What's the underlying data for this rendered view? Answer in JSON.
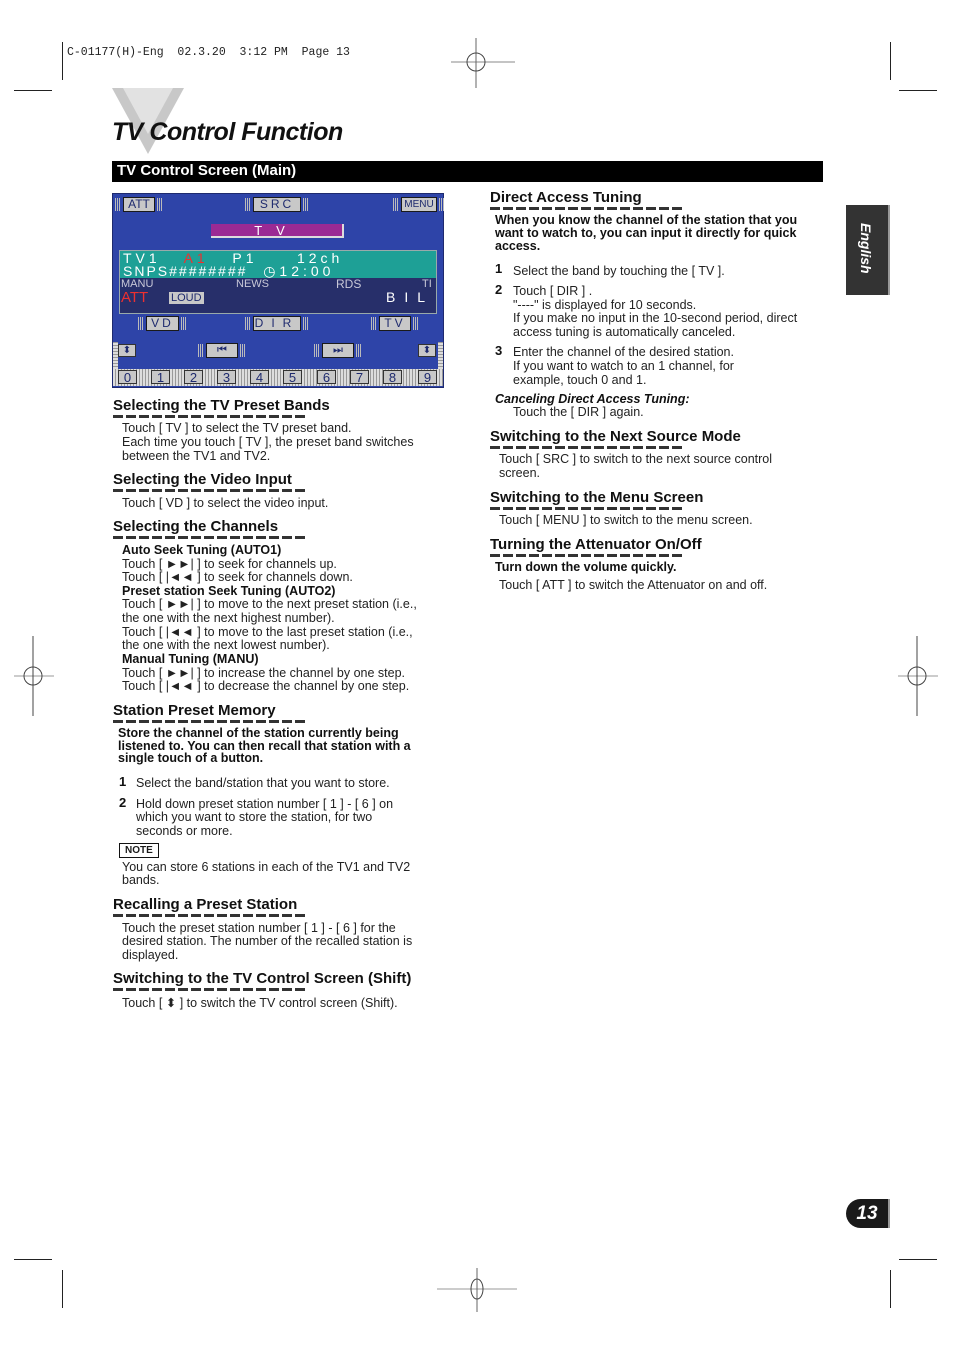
{
  "slug": "C-01177(H)-Eng  02.3.20  3:12 PM  Page 13",
  "page_title": "TV Control Function",
  "section_bar": "TV Control Screen (Main)",
  "side_tab": "English",
  "page_number": "13",
  "lcd": {
    "top_buttons": [
      "ATT",
      "SRC",
      "MENU"
    ],
    "band_label": "TV",
    "line1": {
      "band": "TV1",
      "preset": "A1",
      "p": "P1",
      "channel": "12ch"
    },
    "line2": {
      "name": "SNPS########",
      "clock_icon": "clock-icon",
      "time": "12:00"
    },
    "indicators": {
      "manu": "MANU",
      "news": "NEWS",
      "rds": "RDS",
      "ti": "TI",
      "att": "ATT",
      "loud": "LOUD",
      "bil": "BIL"
    },
    "mid_buttons": [
      "VD",
      "DIR",
      "TV"
    ],
    "seek_buttons": {
      "prev_icon": "seek-back-icon",
      "next_icon": "seek-forward-icon",
      "prev": "⏮",
      "next": "⏭"
    },
    "shift_icon": "⬍",
    "number_keys": [
      "0",
      "1",
      "2",
      "3",
      "4",
      "5",
      "6",
      "7",
      "8",
      "9"
    ]
  },
  "left_col": {
    "preset_bands": {
      "heading": "Selecting the TV Preset Bands",
      "lines": [
        "Touch [ TV ] to select the TV preset band.",
        "Each time you touch [ TV ], the preset band switches",
        "between the TV1 and TV2."
      ]
    },
    "video_input": {
      "heading": "Selecting the Video Input",
      "lines": [
        "Touch [ VD ] to select the video input."
      ]
    },
    "channels": {
      "heading": "Selecting the Channels",
      "auto1_title": "Auto Seek Tuning (AUTO1)",
      "auto1_lines": [
        "Touch [ ►►| ] to seek for channels up.",
        "Touch [ |◄◄ ] to seek for channels down."
      ],
      "auto2_title": "Preset station Seek Tuning (AUTO2)",
      "auto2_lines": [
        "Touch [ ►►| ] to move to the next preset station (i.e.,",
        "the one with the next highest number).",
        "Touch [ |◄◄ ] to move to the last preset station (i.e.,",
        "the one with the next lowest number)."
      ],
      "manu_title": "Manual Tuning (MANU)",
      "manu_lines": [
        "Touch [ ►►| ] to increase the channel by one step.",
        "Touch [ |◄◄ ] to decrease the channel by one step."
      ]
    },
    "preset_memory": {
      "heading": "Station Preset Memory",
      "intro": [
        "Store the channel of the station currently being",
        "listened to. You can then recall that station with a",
        "single touch of a button."
      ],
      "step1": "Select the band/station that you want to store.",
      "step2": [
        "Hold down preset station number [ 1 ] - [ 6 ] on",
        "which you want to store the station, for two",
        "seconds or more."
      ],
      "note_label": "NOTE",
      "note": [
        "You can store 6 stations in each of the TV1 and TV2",
        "bands."
      ]
    },
    "recalling": {
      "heading": "Recalling a Preset Station",
      "lines": [
        "Touch the preset station number [ 1 ] - [ 6 ] for the",
        "desired station. The number of the recalled station is",
        "displayed."
      ]
    },
    "shift": {
      "heading": "Switching to the TV Control Screen (Shift)",
      "line": "Touch [ ⬍ ] to switch the TV control screen (Shift)."
    }
  },
  "right_col": {
    "direct": {
      "heading": "Direct Access Tuning",
      "intro": [
        "When you know the channel of the station that you",
        "want to watch to, you can input it directly for quick",
        "access."
      ],
      "step1": "Select the band by touching the [ TV ].",
      "step2": [
        "Touch [ DIR ] .",
        "\"----\" is displayed for 10 seconds.",
        "If you make no input in the 10-second period, direct",
        "access tuning is automatically canceled."
      ],
      "step3": [
        "Enter the channel of the desired station.",
        "If you want to watch to an 1 channel, for",
        "example, touch 0 and 1."
      ],
      "cancel_title": "Canceling Direct Access Tuning:",
      "cancel_line": "Touch the [ DIR ] again."
    },
    "source": {
      "heading": "Switching to the Next Source Mode",
      "lines": [
        "Touch [ SRC ] to switch to the next source control",
        "screen."
      ]
    },
    "menu": {
      "heading": "Switching to the Menu Screen",
      "line": "Touch [ MENU ] to switch to the menu screen."
    },
    "attenuator": {
      "heading": "Turning the Attenuator On/Off",
      "intro": "Turn down the volume quickly.",
      "line": "Touch [ ATT ] to switch the Attenuator on and off."
    }
  }
}
